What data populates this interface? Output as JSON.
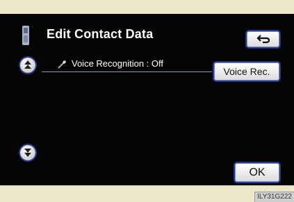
{
  "header": {
    "title": "Edit Contact Data",
    "icon": "phone-icon",
    "back_icon": "back-arrow-icon"
  },
  "list": {
    "items": [
      {
        "icon": "microphone-icon",
        "label": "Voice Recognition : Off"
      }
    ]
  },
  "buttons": {
    "voice_rec_label": "Voice Rec.",
    "ok_label": "OK"
  },
  "scroll": {
    "up_icon": "scroll-up-icon",
    "down_icon": "scroll-down-icon"
  },
  "footer": {
    "code": "ILY31G222"
  },
  "colors": {
    "screen_bg": "#050505",
    "page_bg": "#ece8c9",
    "button_border": "#2a3a8a",
    "row_divider": "#8b97c8"
  }
}
